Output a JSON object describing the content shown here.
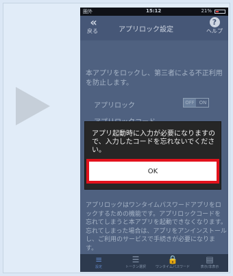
{
  "status": {
    "carrier": "圏外",
    "time": "15:12",
    "battery": "21%"
  },
  "nav": {
    "back_label": "戻る",
    "back_icon": "«",
    "title": "アプリロック設定",
    "help_label": "ヘルプ",
    "help_icon": "?"
  },
  "content": {
    "intro": "本アプリをロックし、第三者による不正利用を防止します。",
    "applock_label": "アプリロック",
    "toggle_off": "OFF",
    "toggle_on": "ON",
    "code_label": "アプリロックコード",
    "description": "アプリロックはワンタイムパスワードアプリをロックするための機能です。アプリロックコードを忘れてしまうと本アプリを起動できなくなります。忘れてしまった場合は、アプリをアンインストールし、ご利用のサービスで手続きが必要になります。"
  },
  "dialog": {
    "message": "アプリ起動時に入力が必要になりますので、入力したコードを忘れないでください。",
    "ok_label": "OK"
  },
  "tabs": [
    {
      "icon": "≡",
      "label": "設定"
    },
    {
      "icon": "☰",
      "label": "トークン選択"
    },
    {
      "icon": "🔒",
      "label": "ワンタイムパスワード"
    },
    {
      "icon": "▤",
      "label": "表示/非表示"
    }
  ]
}
